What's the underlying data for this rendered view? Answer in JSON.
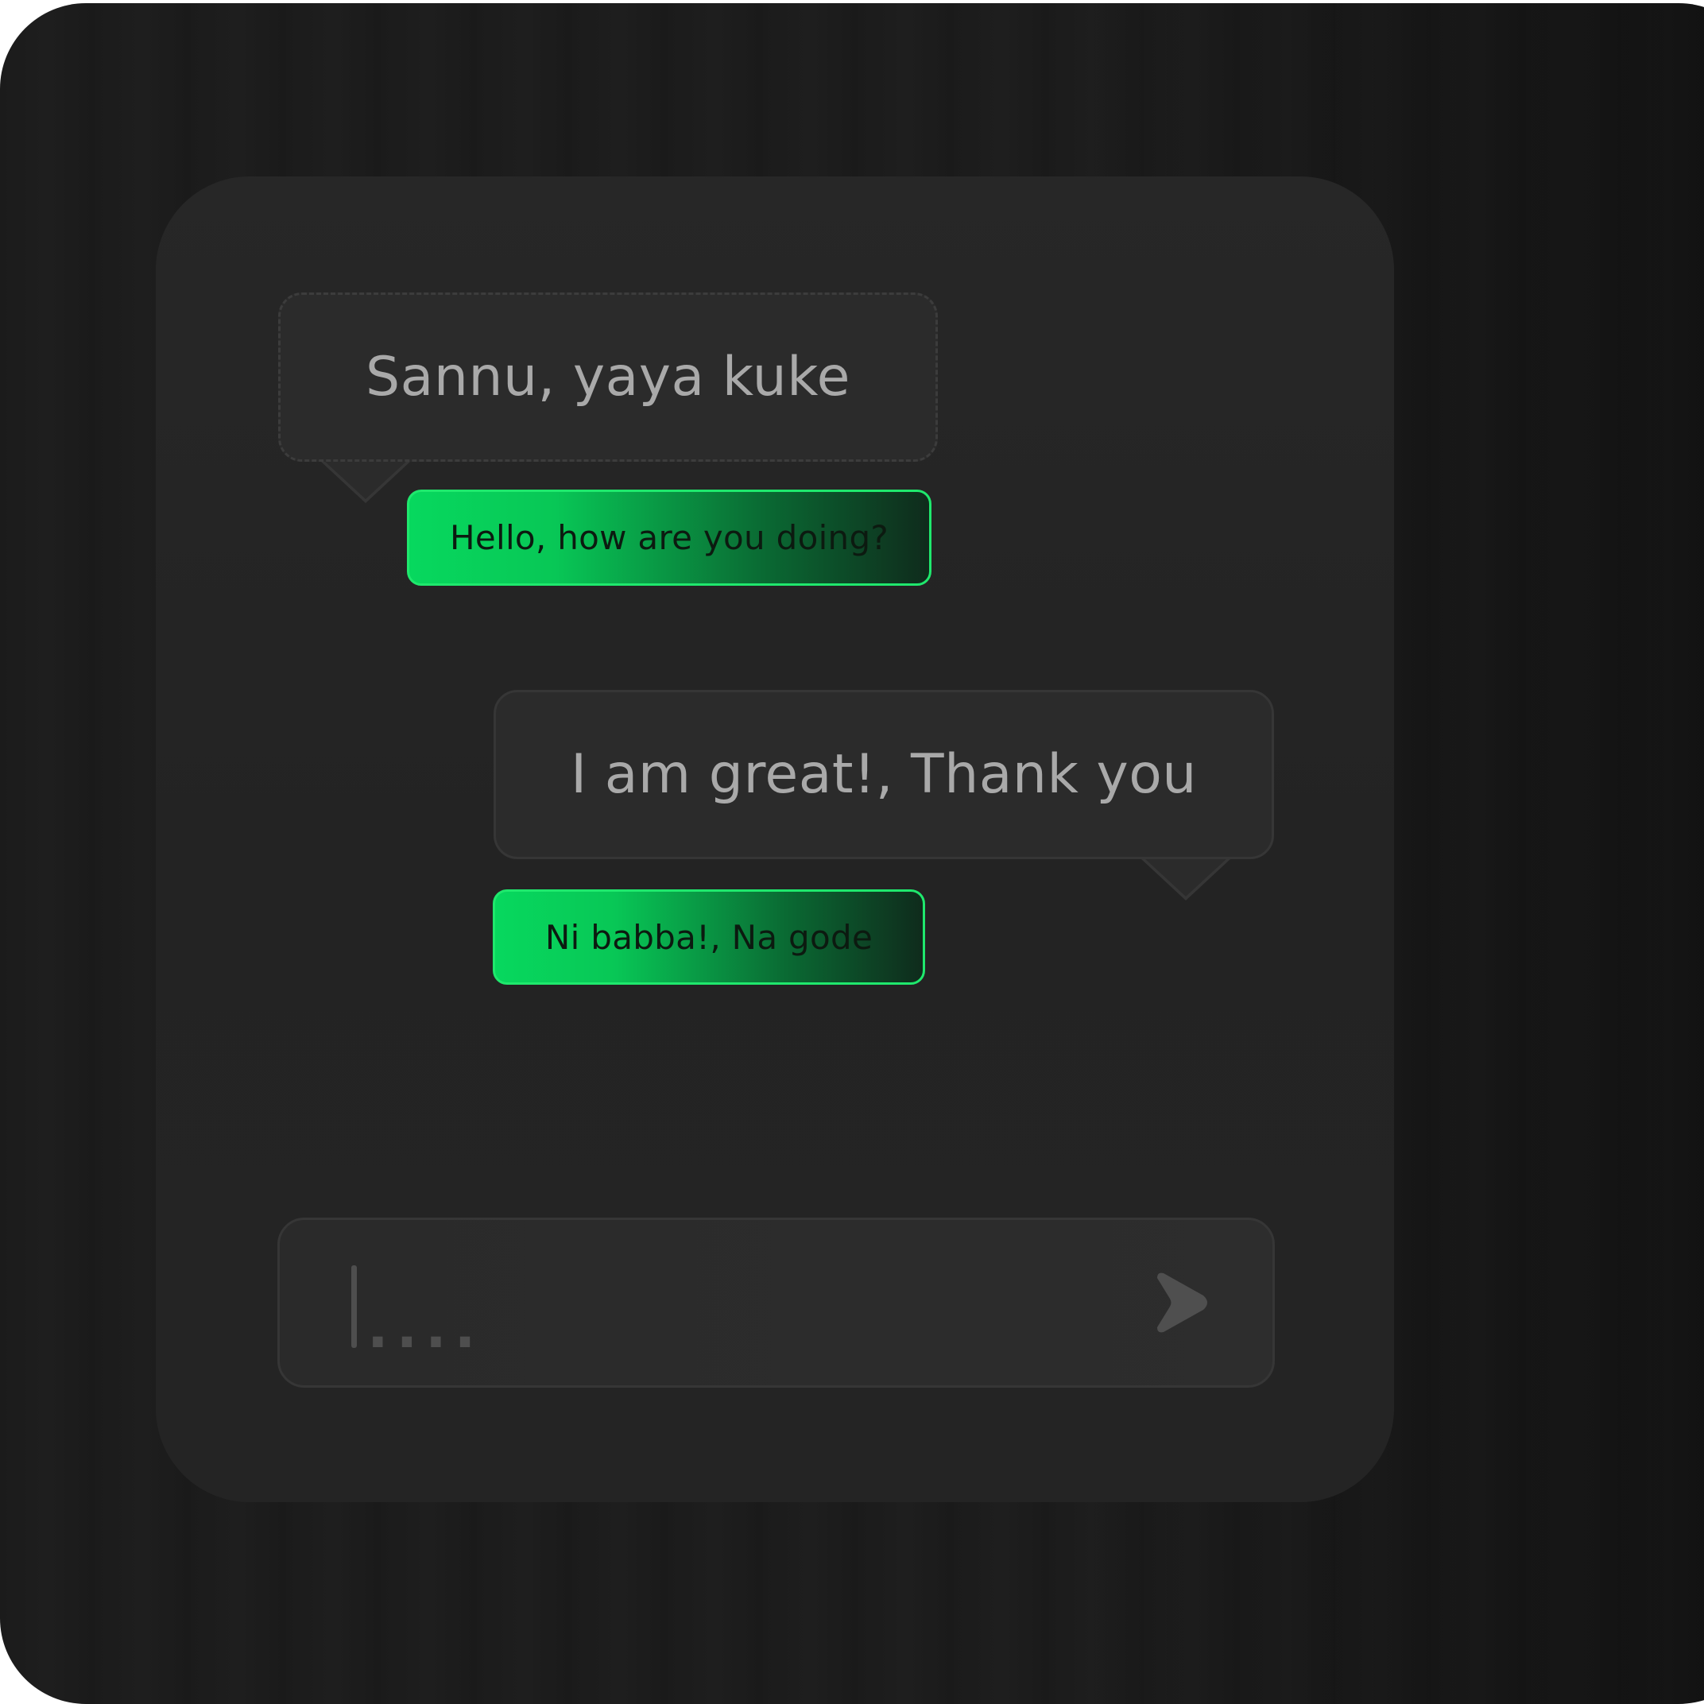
{
  "conversation": {
    "messages": [
      {
        "original": "Sannu, yaya kuke",
        "translation": "Hello, how are you doing?"
      },
      {
        "original": "I am great!, Thank you",
        "translation": "Ni babba!, Na gode"
      }
    ]
  },
  "composer": {
    "placeholder": "...."
  },
  "colors": {
    "accent": "#07d85e",
    "panel": "#262626",
    "bubble": "#2b2b2b"
  }
}
